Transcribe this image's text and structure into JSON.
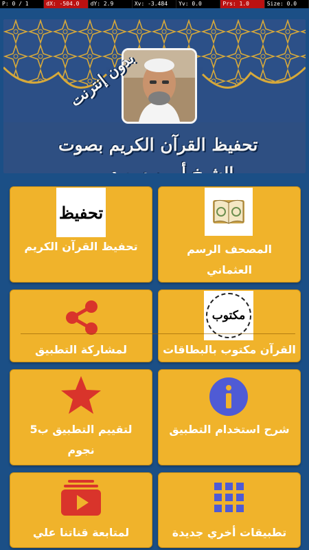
{
  "statusbar": {
    "p": "P: 0 / 1",
    "dx": "dX: -504.0",
    "dy": "dY: 2.9",
    "xv": "Xv: -3.484",
    "yv": "Yv: 0.0",
    "prs": "Prs: 1.0",
    "size": "Size: 0.0"
  },
  "banner": {
    "line1": "تحفيظ القرآن الكريم بصوت",
    "line2": "الشيخ أيمن سويد",
    "tag": "بدون إنترنت"
  },
  "cards": [
    {
      "label": "المصحف الرسم العثماني",
      "icon": "quran-book-icon"
    },
    {
      "label": "تحفيظ القرآن الكريم",
      "icon": "tahfeez-logo-icon",
      "icon_text": "تحفيظ"
    },
    {
      "label": "القرآن مكتوب بالبطاقات",
      "icon": "maktoob-logo-icon",
      "icon_text": "مكتوب"
    },
    {
      "label": "لمشاركة التطبيق",
      "icon": "share-icon"
    },
    {
      "label": "شرح استخدام التطبيق",
      "icon": "info-icon"
    },
    {
      "label": "لتقييم التطبيق ب5 نجوم",
      "icon": "star-icon"
    },
    {
      "label": "تطبيقات أخري جديدة",
      "icon": "grid-apps-icon"
    },
    {
      "label": "لمتابعة قناتنا علي",
      "icon": "youtube-icon"
    }
  ],
  "colors": {
    "background": "#1b4f86",
    "card": "#f0b32b",
    "accent_red": "#d9342b",
    "accent_blue": "#4f5bd5"
  }
}
